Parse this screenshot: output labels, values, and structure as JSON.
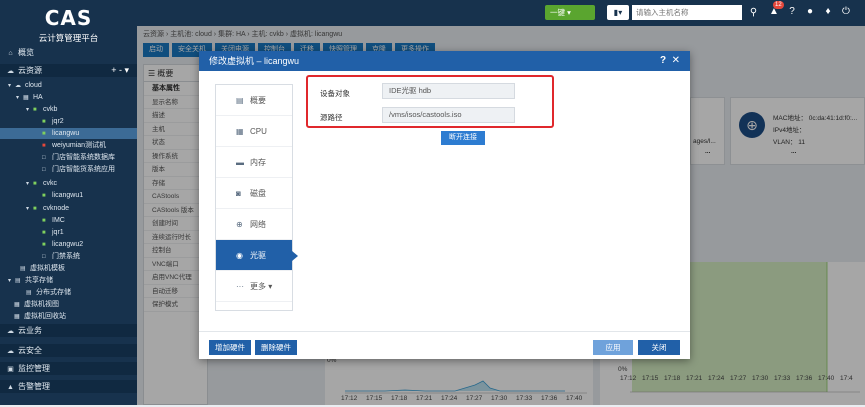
{
  "app": {
    "logo_text": "CAS",
    "subtitle": "云计算管理平台"
  },
  "topbar": {
    "onekey_label": "一键",
    "search_dropdown_icon": "server-icon",
    "search_placeholder": "请输入主机名称",
    "notification_count": "12"
  },
  "sidebar": {
    "items": [
      {
        "label": "概览",
        "icon": "home-icon"
      },
      {
        "label": "云资源",
        "icon": "cloud-icon"
      },
      {
        "label": "云业务",
        "icon": "cloud-service-icon"
      },
      {
        "label": "云安全",
        "icon": "security-icon"
      },
      {
        "label": "监控管理",
        "icon": "monitor-icon"
      },
      {
        "label": "告警管理",
        "icon": "alarm-icon"
      }
    ],
    "tree": [
      {
        "label": "cloud",
        "level": 1
      },
      {
        "label": "HA",
        "level": 2
      },
      {
        "label": "cvkb",
        "level": 3
      },
      {
        "label": "jqr2",
        "level": 4
      },
      {
        "label": "licangwu",
        "level": 4
      },
      {
        "label": "weiyumian测试机",
        "level": 4
      },
      {
        "label": "门店智能系统数据库",
        "level": 4
      },
      {
        "label": "门店智能货系统应用",
        "level": 4
      },
      {
        "label": "cvkc",
        "level": 3
      },
      {
        "label": "licangwu1",
        "level": 4
      },
      {
        "label": "cvknode",
        "level": 3
      },
      {
        "label": "IMC",
        "level": 4
      },
      {
        "label": "jqr1",
        "level": 4
      },
      {
        "label": "licangwu2",
        "level": 4
      },
      {
        "label": "门禁系统",
        "level": 4
      },
      {
        "label": "虚拟机模板",
        "level": 2
      },
      {
        "label": "共享存储",
        "level": 1
      },
      {
        "label": "分布式存储",
        "level": 2
      },
      {
        "label": "虚拟机视图",
        "level": 1
      },
      {
        "label": "虚拟机回收站",
        "level": 1
      }
    ]
  },
  "breadcrumb": {
    "text": "云资源 › 主机池: cloud › 集群: HA › 主机: cvkb › 虚拟机: licangwu"
  },
  "toolbar": {
    "buttons": [
      "启动",
      "安全关机",
      "关闭电源",
      "控制台",
      "迁移",
      "快照管理",
      "克隆",
      "更多操作"
    ]
  },
  "infopanel": {
    "tab_overview": "概要",
    "rows": [
      {
        "label": "基本属性",
        "header": true
      },
      {
        "label": "显示名称"
      },
      {
        "label": "描述"
      },
      {
        "label": "主机"
      },
      {
        "label": "状态"
      },
      {
        "label": "操作系统"
      },
      {
        "label": "版本"
      },
      {
        "label": "存储"
      },
      {
        "label": "CAStools"
      },
      {
        "label": "CAStools 版本"
      },
      {
        "label": "创建时间"
      },
      {
        "label": "连续运行时长"
      },
      {
        "label": "控制台"
      },
      {
        "label": "VNC端口"
      },
      {
        "label": "启用VNC代理"
      },
      {
        "label": "自动迁移"
      },
      {
        "label": "保护模式"
      }
    ]
  },
  "netcard": {
    "mac": "MAC地址： 0c:da:41:1d:f0:...",
    "ipv4": "IPv4地址：",
    "vlan": "VLAN： 11",
    "partial": "ages/l..."
  },
  "chart_left": {
    "zero_label": "0%",
    "x_ticks": [
      "17:12",
      "17:15",
      "17:18",
      "17:21",
      "17:24",
      "17:27",
      "17:30",
      "17:33",
      "17:36",
      "17:40"
    ]
  },
  "chart_right": {
    "zero_label": "0%",
    "x_ticks": [
      "17:12",
      "17:15",
      "17:18",
      "17:21",
      "17:24",
      "17:27",
      "17:30",
      "17:33",
      "17:36",
      "17:40",
      "17:4"
    ]
  },
  "modal": {
    "title": "修改虚拟机 – licangwu",
    "help": "?",
    "close": "✕",
    "nav": [
      {
        "label": "概要",
        "icon": "summary-icon",
        "selected": false
      },
      {
        "label": "CPU",
        "icon": "cpu-icon",
        "selected": false
      },
      {
        "label": "内存",
        "icon": "memory-icon",
        "selected": false
      },
      {
        "label": "磁盘",
        "icon": "disk-icon",
        "selected": false
      },
      {
        "label": "网络",
        "icon": "network-icon",
        "selected": false
      },
      {
        "label": "光驱",
        "icon": "cdrom-icon",
        "selected": true
      },
      {
        "label": "更多",
        "icon": "more-icon",
        "selected": false
      }
    ],
    "device_label": "设备对象",
    "device_value": "IDE光驱 hdb",
    "source_label": "源路径",
    "source_value": "/vms/isos/castools.iso",
    "disconnect": "断开连接",
    "add_hw": "增加硬件",
    "del_hw": "删除硬件",
    "apply": "应用",
    "close_btn": "关闭"
  }
}
